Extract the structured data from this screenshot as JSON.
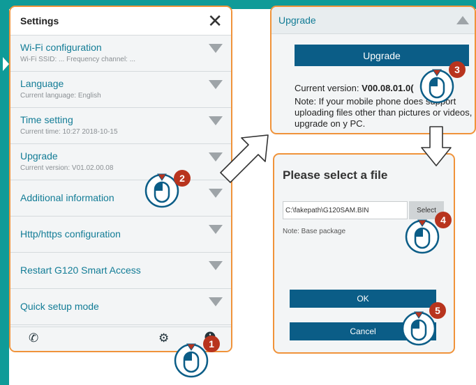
{
  "settings": {
    "title": "Settings",
    "close_icon": "close-icon",
    "items": [
      {
        "label": "Wi-Fi configuration",
        "sub": "Wi-Fi SSID: ...    Frequency channel: ..."
      },
      {
        "label": "Language",
        "sub": "Current language: English"
      },
      {
        "label": "Time setting",
        "sub": "Current time: 10:27 2018-10-15"
      },
      {
        "label": "Upgrade",
        "sub": "Current version: V01.02.00.08"
      },
      {
        "label": "Additional information",
        "sub": ""
      },
      {
        "label": "Http/https configuration",
        "sub": ""
      },
      {
        "label": "Restart G120 Smart Access",
        "sub": ""
      },
      {
        "label": "Quick setup mode",
        "sub": ""
      }
    ],
    "footer_icons": [
      "phone-icon",
      "gear-icon",
      "info-icon"
    ]
  },
  "upgrade_panel": {
    "title": "Upgrade",
    "button": "Upgrade",
    "version_label": "Current version:",
    "version_value": "V00.08.01.0(",
    "note": "Note: If your mobile phone does support uploading files other than pictures or videos, upgrade on y PC."
  },
  "file_dialog": {
    "title": "Please select a file",
    "path": "C:\\fakepath\\G120SAM.BIN",
    "select_button": "Select",
    "note": "Note: Base package",
    "ok_button": "OK",
    "cancel_button": "Cancel"
  },
  "steps": [
    "1",
    "2",
    "3",
    "4",
    "5"
  ],
  "colors": {
    "accent_orange": "#f0933a",
    "button_blue": "#0b5d87",
    "link_teal": "#127c96",
    "badge_red": "#b8341e",
    "frame_teal": "#0f9b98"
  }
}
